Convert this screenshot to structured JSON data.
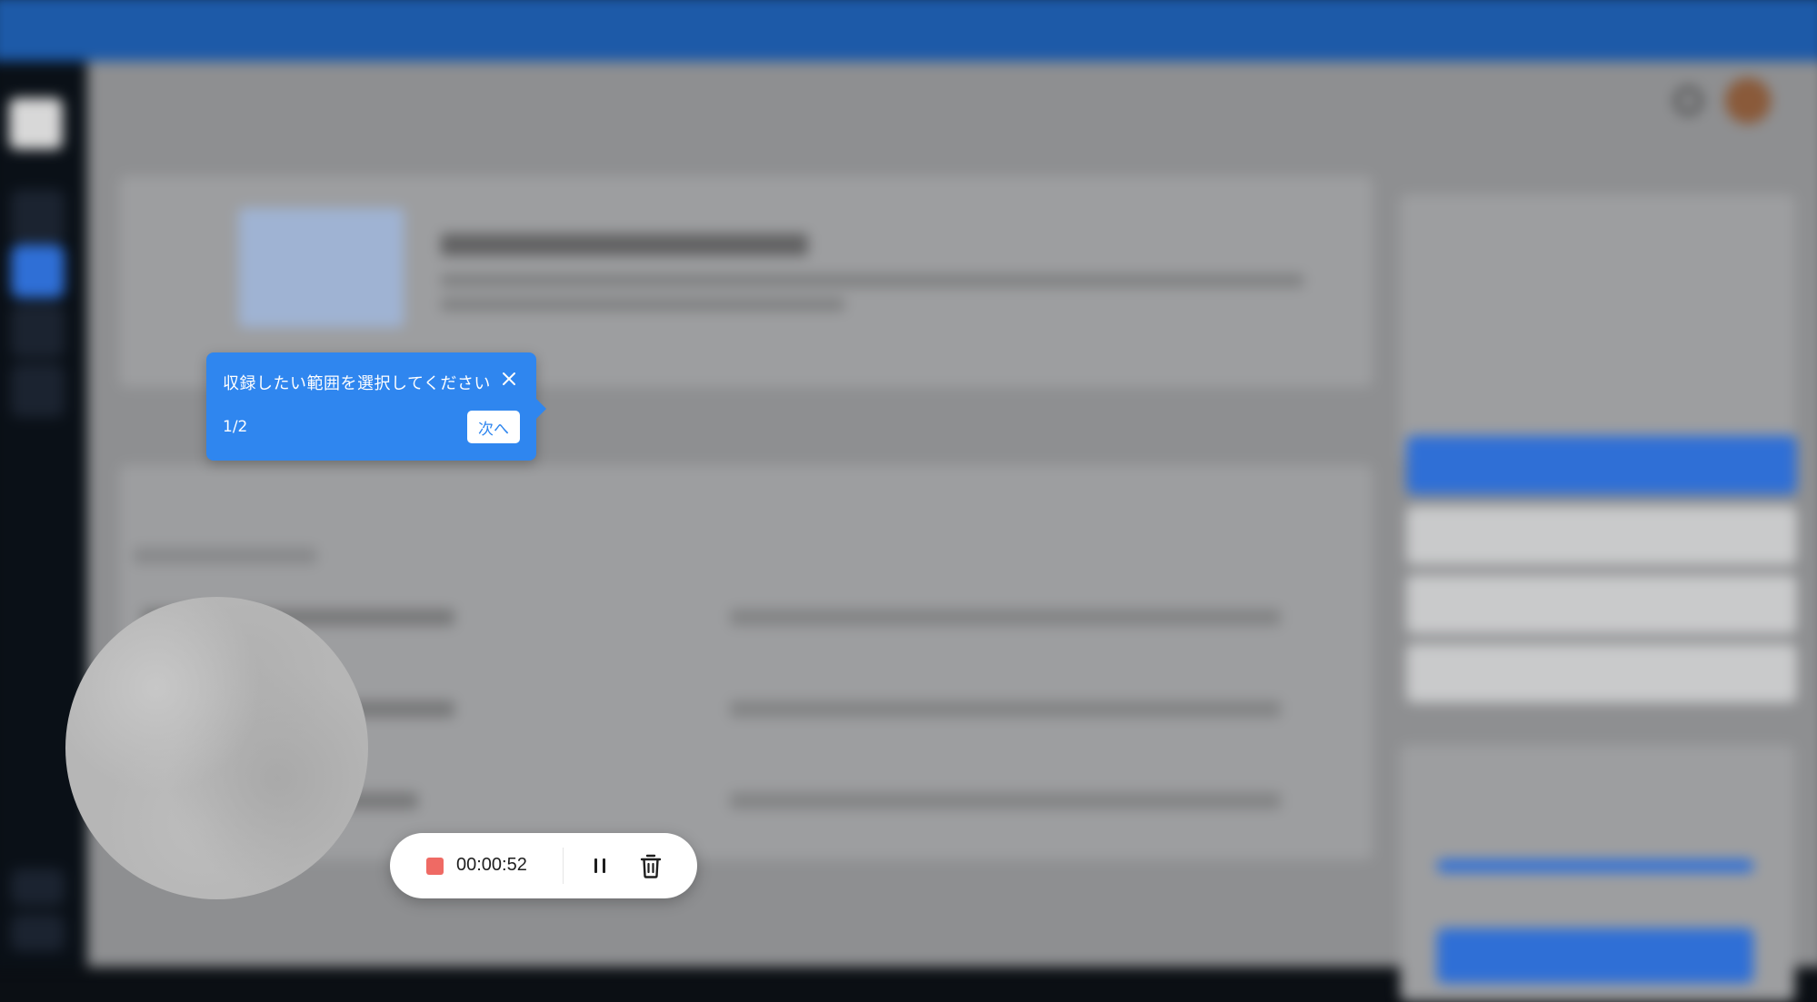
{
  "tooltip": {
    "message": "収録したい範囲を選択してください",
    "step": "1/2",
    "next_label": "次へ"
  },
  "recorder": {
    "elapsed": "00:00:52"
  },
  "icons": {
    "close": "close-icon",
    "stop": "stop-icon",
    "pause": "pause-icon",
    "trash": "trash-icon"
  },
  "colors": {
    "tooltip_bg": "#2f86ef",
    "stop_red": "#ef6a64",
    "topbar_blue": "#1d5aa8"
  }
}
